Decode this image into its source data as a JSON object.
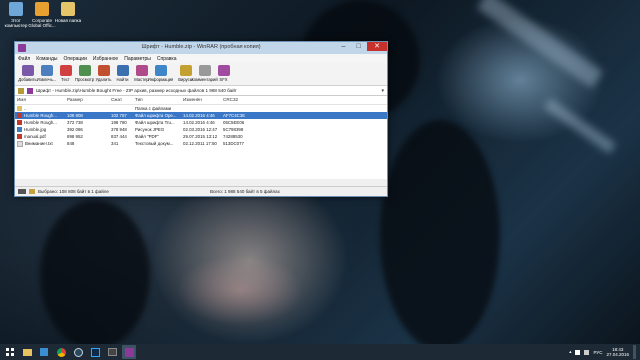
{
  "desktop": {
    "icons": [
      {
        "label": "Этот компьютер",
        "icon": "computer-icon"
      },
      {
        "label": "Corporate Global Offic...",
        "icon": "office-icon"
      },
      {
        "label": "Новая папка",
        "icon": "folder-icon"
      }
    ]
  },
  "window": {
    "title": "Шрифт - Humble.zip - WinRAR (пробная копия)",
    "controls": {
      "minimize": "–",
      "maximize": "□",
      "close": "✕"
    },
    "menu": [
      "Файл",
      "Команды",
      "Операции",
      "Избранное",
      "Параметры",
      "Справка"
    ],
    "toolbar": [
      {
        "label": "Добавить",
        "icon": "add-icon",
        "color": "#7a5aa8"
      },
      {
        "label": "Извлечь...",
        "icon": "extract-icon",
        "color": "#4d7fbf"
      },
      {
        "label": "Тест",
        "icon": "test-icon",
        "color": "#d04040"
      },
      {
        "label": "Просмотр",
        "icon": "view-icon",
        "color": "#4f8f4f"
      },
      {
        "label": "Удалить",
        "icon": "delete-icon",
        "color": "#c05030"
      },
      {
        "label": "Найти",
        "icon": "find-icon",
        "color": "#3a6fb0"
      },
      {
        "label": "Мастер",
        "icon": "wizard-icon",
        "color": "#b04a8a"
      },
      {
        "label": "Информация",
        "icon": "info-icon",
        "color": "#3e86c8"
      },
      {
        "label": "Вирусы",
        "icon": "virus-icon",
        "color": "#c4a030"
      },
      {
        "label": "Комментарий",
        "icon": "comment-icon",
        "color": "#999999"
      },
      {
        "label": "SFX",
        "icon": "sfx-icon",
        "color": "#a04aa0"
      }
    ],
    "path": "Шрифт - Humble.zip\\Humble Bought Free - ZIP архив, размер исходных файлов 1 988 540 байт",
    "columns": [
      "Имя",
      "Размер",
      "Сжат",
      "Тип",
      "Изменён",
      "CRC32"
    ],
    "files": [
      {
        "name": "..",
        "size": "",
        "packed": "",
        "type": "Папка с файлами",
        "modified": "",
        "crc": "",
        "selected": false,
        "color": "#e0c060"
      },
      {
        "name": "Humble Rough...",
        "size": "108 808",
        "packed": "102 787",
        "type": "Файл шрифта Ope...",
        "modified": "14.02.2016 4:46",
        "crc": "AF7C4C3E",
        "selected": true,
        "color": "#c0392b"
      },
      {
        "name": "Humble Rough...",
        "size": "372 738",
        "packed": "198 780",
        "type": "Файл шрифта Tru...",
        "modified": "14.02.2016 4:46",
        "crc": "05C5EE06",
        "selected": false,
        "color": "#c0392b"
      },
      {
        "name": "Humble.jpg",
        "size": "392 086",
        "packed": "378 948",
        "type": "Рисунок JPEG",
        "modified": "02.03.2016 12:47",
        "crc": "5C798398",
        "selected": false,
        "color": "#3a7dc0"
      },
      {
        "name": "manual.pdf",
        "size": "898 952",
        "packed": "837 444",
        "type": "Файл \"PDF\"",
        "modified": "29.07.2015 13:12",
        "crc": "74288530",
        "selected": false,
        "color": "#c0392b"
      },
      {
        "name": "Внимание!.txt",
        "size": "848",
        "packed": "341",
        "type": "Текстовый докум...",
        "modified": "02.12.2011 17:50",
        "crc": "513DC077",
        "selected": false,
        "color": "#dddddd"
      }
    ],
    "status_left": "Выбрано: 108 808 байт в 1 файле",
    "status_right": "Всего: 1 988 540 байт в 5 файлах"
  },
  "taskbar": {
    "items": [
      {
        "icon": "windows-start-icon",
        "active": false
      },
      {
        "icon": "file-explorer-icon",
        "active": false
      },
      {
        "icon": "store-icon",
        "active": false
      },
      {
        "icon": "chrome-icon",
        "active": false
      },
      {
        "icon": "steam-icon",
        "active": false
      },
      {
        "icon": "photoshop-icon",
        "active": false
      },
      {
        "icon": "media-player-icon",
        "active": false
      },
      {
        "icon": "winrar-icon",
        "active": true
      }
    ],
    "lang": "РУС",
    "time": "18:43",
    "date": "27.04.2016"
  }
}
